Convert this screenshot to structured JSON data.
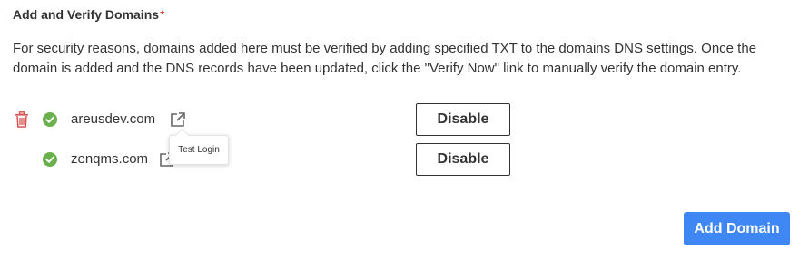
{
  "section": {
    "title": "Add and Verify Domains",
    "required_mark": "*",
    "description": "For security reasons, domains added here must be verified by adding specified TXT to the domains DNS settings. Once the domain is added and the DNS records have been updated, click the \"Verify Now\" link to manually verify the domain entry."
  },
  "domains": [
    {
      "name": "areusdev.com",
      "verified": true,
      "action_label": "Disable",
      "has_delete": true
    },
    {
      "name": "zenqms.com",
      "verified": true,
      "action_label": "Disable",
      "has_delete": false
    }
  ],
  "tooltip": {
    "text": "Test Login"
  },
  "add_button": {
    "label": "Add Domain"
  },
  "colors": {
    "accent": "#3f87f5",
    "verified": "#6ab04c",
    "delete": "#d9534f",
    "required": "#c0392b"
  },
  "icons": [
    "trash-icon",
    "check-circle-icon",
    "external-link-icon"
  ]
}
